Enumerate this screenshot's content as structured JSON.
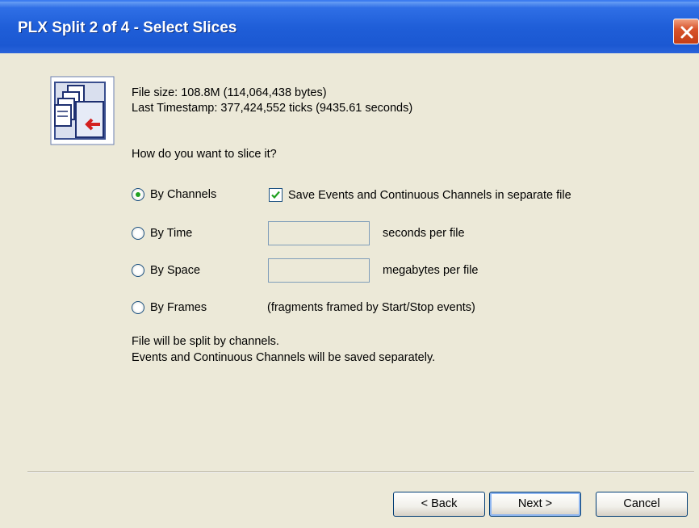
{
  "window": {
    "title": "PLX Split 2 of 4 - Select Slices"
  },
  "info": {
    "file_size": "File size: 108.8M (114,064,438 bytes)",
    "last_timestamp": "Last Timestamp: 377,424,552 ticks (9435.61 seconds)"
  },
  "question": "How do you want to slice it?",
  "options": {
    "by_channels": {
      "label": "By Channels",
      "checked": true
    },
    "by_time": {
      "label": "By Time",
      "checked": false
    },
    "by_space": {
      "label": "By Space",
      "checked": false
    },
    "by_frames": {
      "label": "By Frames",
      "checked": false
    }
  },
  "separate_file_checkbox": {
    "label": "Save Events and Continuous Channels in separate file",
    "checked": true
  },
  "time_field": {
    "value": "",
    "unit": "seconds per file"
  },
  "space_field": {
    "value": "",
    "unit": "megabytes per file"
  },
  "frames_note": "(fragments framed by Start/Stop events)",
  "status": {
    "line1": "File will be split by channels.",
    "line2": "Events and Continuous Channels will be saved separately."
  },
  "buttons": {
    "back": "< Back",
    "next": "Next >",
    "cancel": "Cancel"
  },
  "colors": {
    "titlebar": "#1f5ed8",
    "dialog_bg": "#ece9d8",
    "radio_dot": "#21a121"
  }
}
